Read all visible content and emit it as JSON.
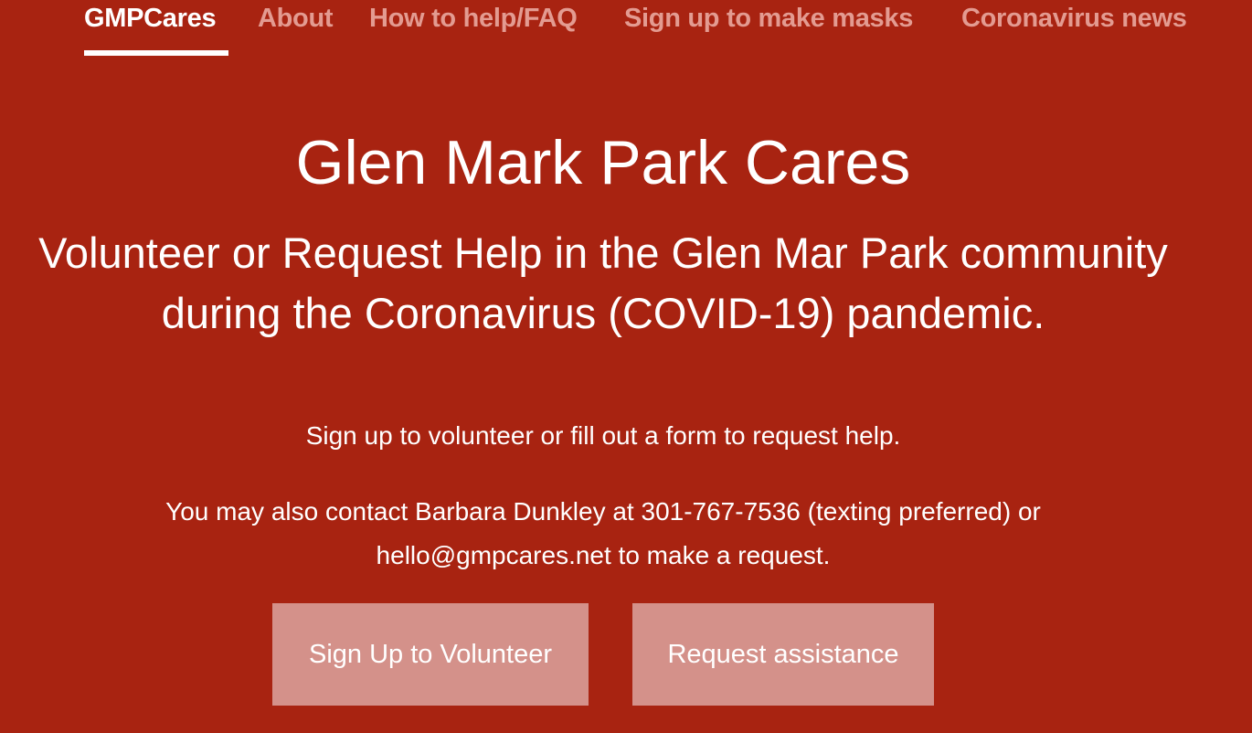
{
  "nav": {
    "items": [
      {
        "label": "GMPCares",
        "active": true
      },
      {
        "label": "About",
        "active": false
      },
      {
        "label": "How to help/FAQ",
        "active": false
      },
      {
        "label": "Sign up to make masks",
        "active": false
      },
      {
        "label": "Coronavirus news",
        "active": false
      }
    ]
  },
  "hero": {
    "title": "Glen Mark Park Cares",
    "subtitle": "Volunteer or Request Help in the Glen Mar Park community during the Coronavirus (COVID-19) pandemic.",
    "lead": "Sign up to volunteer or fill out a form to request help.",
    "contact": "You may also contact Barbara Dunkley at 301-767-7536 (texting preferred) or hello@gmpcares.net to make a request."
  },
  "buttons": {
    "volunteer_label": "Sign Up to Volunteer",
    "request_label": "Request assistance"
  },
  "colors": {
    "background": "#a82311",
    "nav_inactive": "#e39b91",
    "button_bg": "#d4918a",
    "text": "#ffffff"
  }
}
